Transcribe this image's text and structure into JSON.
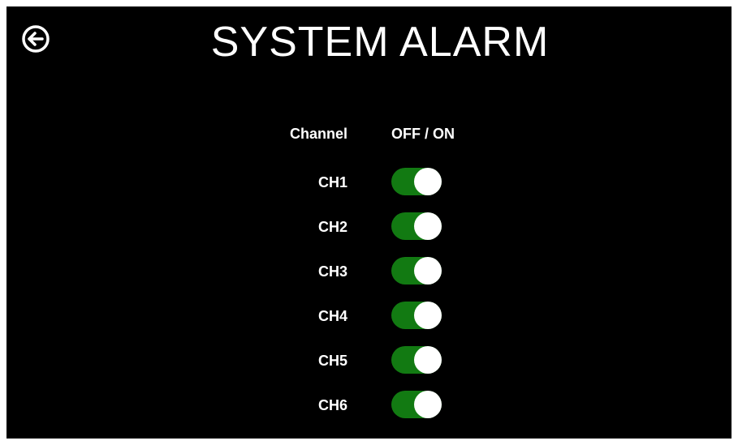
{
  "header": {
    "title": "SYSTEM ALARM",
    "back_icon": "circle-arrow-left-icon"
  },
  "table": {
    "columns": [
      "Channel",
      "OFF / ON"
    ],
    "rows": [
      {
        "label": "CH1",
        "state": "on"
      },
      {
        "label": "CH2",
        "state": "on"
      },
      {
        "label": "CH3",
        "state": "on"
      },
      {
        "label": "CH4",
        "state": "on"
      },
      {
        "label": "CH5",
        "state": "on"
      },
      {
        "label": "CH6",
        "state": "on"
      }
    ]
  },
  "colors": {
    "background": "#000000",
    "toggle_on": "#127a12",
    "text": "#ffffff"
  }
}
